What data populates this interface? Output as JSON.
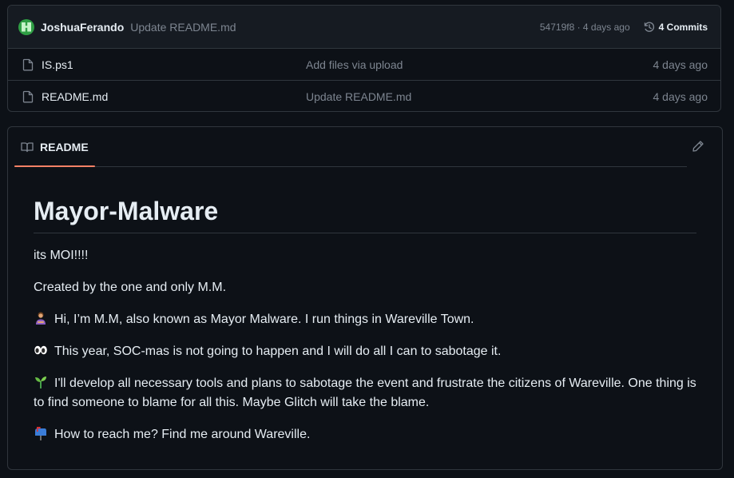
{
  "commit_bar": {
    "author": "JoshuaFerando",
    "message": "Update README.md",
    "sha_time": "54719f8 · 4 days ago",
    "commits_label": "4 Commits"
  },
  "files": [
    {
      "name": "IS.ps1",
      "commit": "Add files via upload",
      "date": "4 days ago"
    },
    {
      "name": "README.md",
      "commit": "Update README.md",
      "date": "4 days ago"
    }
  ],
  "readme": {
    "tab_label": "README",
    "title": "Mayor-Malware",
    "paragraphs": [
      "its MOI!!!!",
      "Created by the one and only M.M.",
      "Hi, I’m M.M, also known as Mayor Malware. I run things in Wareville Town.",
      "This year, SOC-mas is not going to happen and I will do all I can to sabotage it.",
      "I'll develop all necessary tools and plans to sabotage the event and frustrate the citizens of Wareville. One thing is to find someone to blame for all this. Maybe Glitch will take the blame.",
      "How to reach me? Find me around Wareville."
    ],
    "emojis": [
      "person-emoji",
      "eyes-emoji",
      "seedling-emoji",
      "mailbox-emoji"
    ]
  },
  "colors": {
    "background": "#0d1117",
    "header_bg": "#161b22",
    "border": "#30363d",
    "muted": "#7d8590",
    "text": "#e6edf3",
    "tab_underline": "#f78166"
  }
}
